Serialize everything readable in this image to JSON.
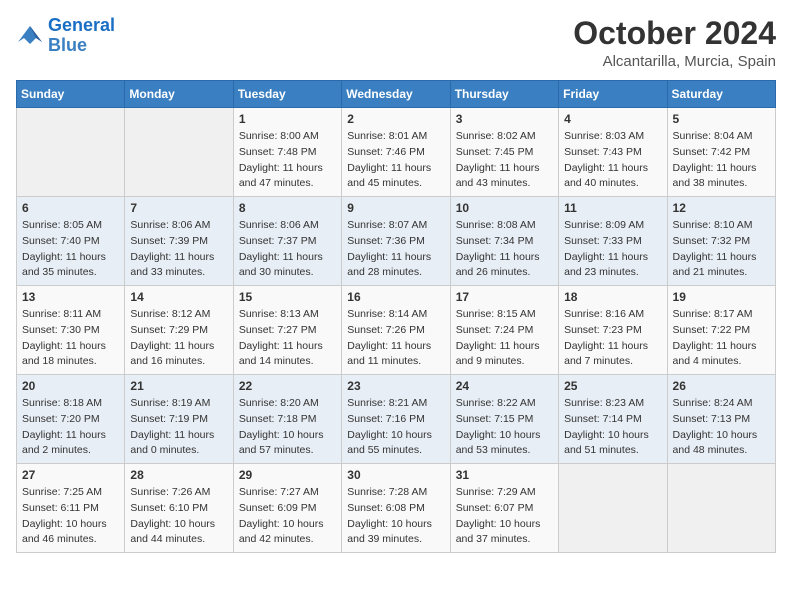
{
  "logo": {
    "text_general": "General",
    "text_blue": "Blue"
  },
  "title": "October 2024",
  "location": "Alcantarilla, Murcia, Spain",
  "weekdays": [
    "Sunday",
    "Monday",
    "Tuesday",
    "Wednesday",
    "Thursday",
    "Friday",
    "Saturday"
  ],
  "weeks": [
    [
      {
        "day": "",
        "info": ""
      },
      {
        "day": "",
        "info": ""
      },
      {
        "day": "1",
        "info": "Sunrise: 8:00 AM\nSunset: 7:48 PM\nDaylight: 11 hours and 47 minutes."
      },
      {
        "day": "2",
        "info": "Sunrise: 8:01 AM\nSunset: 7:46 PM\nDaylight: 11 hours and 45 minutes."
      },
      {
        "day": "3",
        "info": "Sunrise: 8:02 AM\nSunset: 7:45 PM\nDaylight: 11 hours and 43 minutes."
      },
      {
        "day": "4",
        "info": "Sunrise: 8:03 AM\nSunset: 7:43 PM\nDaylight: 11 hours and 40 minutes."
      },
      {
        "day": "5",
        "info": "Sunrise: 8:04 AM\nSunset: 7:42 PM\nDaylight: 11 hours and 38 minutes."
      }
    ],
    [
      {
        "day": "6",
        "info": "Sunrise: 8:05 AM\nSunset: 7:40 PM\nDaylight: 11 hours and 35 minutes."
      },
      {
        "day": "7",
        "info": "Sunrise: 8:06 AM\nSunset: 7:39 PM\nDaylight: 11 hours and 33 minutes."
      },
      {
        "day": "8",
        "info": "Sunrise: 8:06 AM\nSunset: 7:37 PM\nDaylight: 11 hours and 30 minutes."
      },
      {
        "day": "9",
        "info": "Sunrise: 8:07 AM\nSunset: 7:36 PM\nDaylight: 11 hours and 28 minutes."
      },
      {
        "day": "10",
        "info": "Sunrise: 8:08 AM\nSunset: 7:34 PM\nDaylight: 11 hours and 26 minutes."
      },
      {
        "day": "11",
        "info": "Sunrise: 8:09 AM\nSunset: 7:33 PM\nDaylight: 11 hours and 23 minutes."
      },
      {
        "day": "12",
        "info": "Sunrise: 8:10 AM\nSunset: 7:32 PM\nDaylight: 11 hours and 21 minutes."
      }
    ],
    [
      {
        "day": "13",
        "info": "Sunrise: 8:11 AM\nSunset: 7:30 PM\nDaylight: 11 hours and 18 minutes."
      },
      {
        "day": "14",
        "info": "Sunrise: 8:12 AM\nSunset: 7:29 PM\nDaylight: 11 hours and 16 minutes."
      },
      {
        "day": "15",
        "info": "Sunrise: 8:13 AM\nSunset: 7:27 PM\nDaylight: 11 hours and 14 minutes."
      },
      {
        "day": "16",
        "info": "Sunrise: 8:14 AM\nSunset: 7:26 PM\nDaylight: 11 hours and 11 minutes."
      },
      {
        "day": "17",
        "info": "Sunrise: 8:15 AM\nSunset: 7:24 PM\nDaylight: 11 hours and 9 minutes."
      },
      {
        "day": "18",
        "info": "Sunrise: 8:16 AM\nSunset: 7:23 PM\nDaylight: 11 hours and 7 minutes."
      },
      {
        "day": "19",
        "info": "Sunrise: 8:17 AM\nSunset: 7:22 PM\nDaylight: 11 hours and 4 minutes."
      }
    ],
    [
      {
        "day": "20",
        "info": "Sunrise: 8:18 AM\nSunset: 7:20 PM\nDaylight: 11 hours and 2 minutes."
      },
      {
        "day": "21",
        "info": "Sunrise: 8:19 AM\nSunset: 7:19 PM\nDaylight: 11 hours and 0 minutes."
      },
      {
        "day": "22",
        "info": "Sunrise: 8:20 AM\nSunset: 7:18 PM\nDaylight: 10 hours and 57 minutes."
      },
      {
        "day": "23",
        "info": "Sunrise: 8:21 AM\nSunset: 7:16 PM\nDaylight: 10 hours and 55 minutes."
      },
      {
        "day": "24",
        "info": "Sunrise: 8:22 AM\nSunset: 7:15 PM\nDaylight: 10 hours and 53 minutes."
      },
      {
        "day": "25",
        "info": "Sunrise: 8:23 AM\nSunset: 7:14 PM\nDaylight: 10 hours and 51 minutes."
      },
      {
        "day": "26",
        "info": "Sunrise: 8:24 AM\nSunset: 7:13 PM\nDaylight: 10 hours and 48 minutes."
      }
    ],
    [
      {
        "day": "27",
        "info": "Sunrise: 7:25 AM\nSunset: 6:11 PM\nDaylight: 10 hours and 46 minutes."
      },
      {
        "day": "28",
        "info": "Sunrise: 7:26 AM\nSunset: 6:10 PM\nDaylight: 10 hours and 44 minutes."
      },
      {
        "day": "29",
        "info": "Sunrise: 7:27 AM\nSunset: 6:09 PM\nDaylight: 10 hours and 42 minutes."
      },
      {
        "day": "30",
        "info": "Sunrise: 7:28 AM\nSunset: 6:08 PM\nDaylight: 10 hours and 39 minutes."
      },
      {
        "day": "31",
        "info": "Sunrise: 7:29 AM\nSunset: 6:07 PM\nDaylight: 10 hours and 37 minutes."
      },
      {
        "day": "",
        "info": ""
      },
      {
        "day": "",
        "info": ""
      }
    ]
  ]
}
